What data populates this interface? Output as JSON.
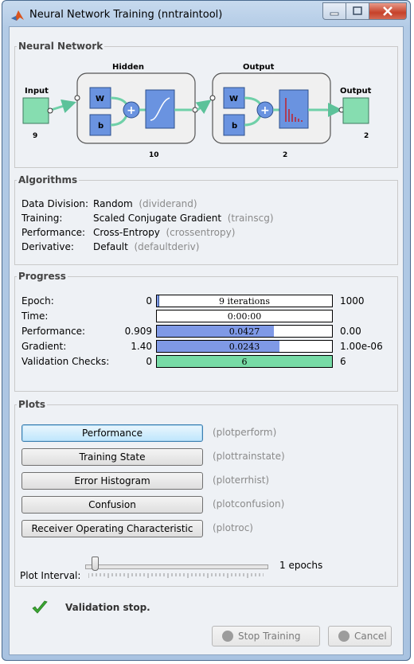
{
  "window": {
    "title": "Neural Network Training (nntraintool)"
  },
  "network": {
    "group_label": "Neural Network",
    "input_label": "Input",
    "input_size": "9",
    "hidden_label": "Hidden",
    "hidden_size": "10",
    "output_layer_label": "Output",
    "output_layer_size": "2",
    "output_label": "Output",
    "output_size": "2",
    "weight_symbol": "W",
    "bias_symbol": "b",
    "sum_symbol": "+"
  },
  "algorithms": {
    "group_label": "Algorithms",
    "rows": [
      {
        "key": "Data Division:",
        "value": "Random",
        "func": "(dividerand)"
      },
      {
        "key": "Training:",
        "value": "Scaled Conjugate Gradient",
        "func": "(trainscg)"
      },
      {
        "key": "Performance:",
        "value": "Cross-Entropy",
        "func": "(crossentropy)"
      },
      {
        "key": "Derivative:",
        "value": "Default",
        "func": "(defaultderiv)"
      }
    ]
  },
  "progress": {
    "group_label": "Progress",
    "rows": [
      {
        "label": "Epoch:",
        "start": "0",
        "current": "9 iterations",
        "end": "1000",
        "fraction": 0.009,
        "color": "#7f99e6"
      },
      {
        "label": "Time:",
        "start": "",
        "current": "0:00:00",
        "end": "",
        "fraction": 0,
        "color": "#7f99e6"
      },
      {
        "label": "Performance:",
        "start": "0.909",
        "current": "0.0427",
        "end": "0.00",
        "fraction": 0.67,
        "color": "#7f99e6"
      },
      {
        "label": "Gradient:",
        "start": "1.40",
        "current": "0.0243",
        "end": "1.00e-06",
        "fraction": 0.7,
        "color": "#7f99e6"
      },
      {
        "label": "Validation Checks:",
        "start": "0",
        "current": "6",
        "end": "6",
        "fraction": 1.0,
        "color": "#77dba6"
      }
    ]
  },
  "plots": {
    "group_label": "Plots",
    "buttons": [
      {
        "label": "Performance",
        "func": "(plotperform)"
      },
      {
        "label": "Training State",
        "func": "(plottrainstate)"
      },
      {
        "label": "Error Histogram",
        "func": "(ploterrhist)"
      },
      {
        "label": "Confusion",
        "func": "(plotconfusion)"
      },
      {
        "label": "Receiver Operating Characteristic",
        "func": "(plotroc)"
      }
    ],
    "interval_label": "Plot Interval:",
    "interval_value": "1 epochs"
  },
  "status": {
    "text": "Validation stop."
  },
  "buttons": {
    "stop": "Stop Training",
    "cancel": "Cancel"
  },
  "colors": {
    "layer_box": "#6a93e0",
    "input_box": "#86ddb0",
    "connector": "#6fd0a8",
    "check": "#3aa832"
  }
}
